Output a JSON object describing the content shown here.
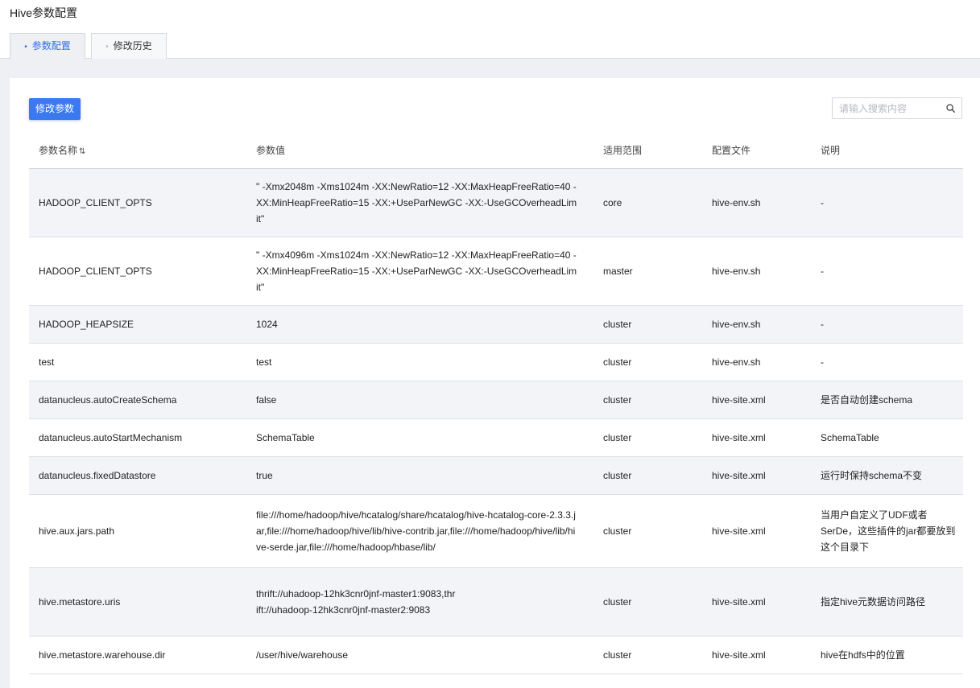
{
  "page": {
    "title": "Hive参数配置"
  },
  "tabs": [
    {
      "label": "参数配置",
      "active": true
    },
    {
      "label": "修改历史",
      "active": false
    }
  ],
  "toolbar": {
    "modify_button": "修改参数",
    "search_placeholder": "请输入搜索内容"
  },
  "colors": {
    "accent": "#3a7af0",
    "active_tab_text": "#2e6be6",
    "page_bg": "#eef0f4",
    "row_stripe": "#f2f4f7"
  },
  "table": {
    "headers": [
      "参数名称",
      "参数值",
      "适用范围",
      "配置文件",
      "说明"
    ],
    "sort_icon": "sort-updown-icon",
    "rows": [
      {
        "name": "HADOOP_CLIENT_OPTS",
        "value": "\" -Xmx2048m -Xms1024m -XX:NewRatio=12 -XX:MaxHeapFreeRatio=40 -XX:MinHeapFreeRatio=15 -XX:+UseParNewGC -XX:-UseGCOverheadLimit\"",
        "scope": "core",
        "file": "hive-env.sh",
        "desc": "-"
      },
      {
        "name": "HADOOP_CLIENT_OPTS",
        "value": "\" -Xmx4096m -Xms1024m -XX:NewRatio=12 -XX:MaxHeapFreeRatio=40 -XX:MinHeapFreeRatio=15 -XX:+UseParNewGC -XX:-UseGCOverheadLimit\"",
        "scope": "master",
        "file": "hive-env.sh",
        "desc": "-"
      },
      {
        "name": "HADOOP_HEAPSIZE",
        "value": "1024",
        "scope": "cluster",
        "file": "hive-env.sh",
        "desc": "-"
      },
      {
        "name": "test",
        "value": "test",
        "scope": "cluster",
        "file": "hive-env.sh",
        "desc": "-"
      },
      {
        "name": "datanucleus.autoCreateSchema",
        "value": "false",
        "scope": "cluster",
        "file": "hive-site.xml",
        "desc": "是否自动创建schema"
      },
      {
        "name": "datanucleus.autoStartMechanism",
        "value": "SchemaTable",
        "scope": "cluster",
        "file": "hive-site.xml",
        "desc": "SchemaTable"
      },
      {
        "name": "datanucleus.fixedDatastore",
        "value": "true",
        "scope": "cluster",
        "file": "hive-site.xml",
        "desc": "运行时保持schema不变"
      },
      {
        "name": "hive.aux.jars.path",
        "value": "file:///home/hadoop/hive/hcatalog/share/hcatalog/hive-hcatalog-core-2.3.3.jar,file:///home/hadoop/hive/lib/hive-contrib.jar,file:///home/hadoop/hive/lib/hive-serde.jar,file:///home/hadoop/hbase/lib/",
        "scope": "cluster",
        "file": "hive-site.xml",
        "desc": "当用户自定义了UDF或者SerDe，这些插件的jar都要放到这个目录下"
      },
      {
        "name": "hive.metastore.uris",
        "value": "thrift://uhadoop-12hk3cnr0jnf-master1:9083,thrift://uhadoop-12hk3cnr0jnf-master2:9083",
        "scope": "cluster",
        "file": "hive-site.xml",
        "desc": "指定hive元数据访问路径"
      },
      {
        "name": "hive.metastore.warehouse.dir",
        "value": "/user/hive/warehouse",
        "scope": "cluster",
        "file": "hive-site.xml",
        "desc": "hive在hdfs中的位置"
      }
    ]
  }
}
